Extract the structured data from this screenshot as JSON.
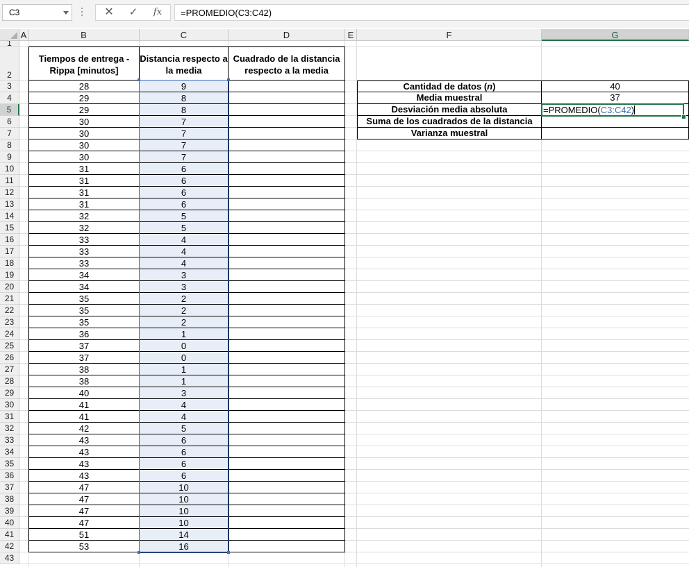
{
  "name_box": "C3",
  "formula_bar": {
    "cancel_icon": "✕",
    "enter_icon": "✓",
    "fx_label": "fx",
    "formula": "=PROMEDIO(C3:C42)"
  },
  "columns": [
    "A",
    "B",
    "C",
    "D",
    "E",
    "F",
    "G"
  ],
  "rows": [
    "1",
    "2",
    "3",
    "4",
    "5",
    "6",
    "7",
    "8",
    "9",
    "10",
    "11",
    "12",
    "13",
    "14",
    "15",
    "16",
    "17",
    "18",
    "19",
    "20",
    "21",
    "22",
    "23",
    "24",
    "25",
    "26",
    "27",
    "28",
    "29",
    "30",
    "31",
    "32",
    "33",
    "34",
    "35",
    "36",
    "37",
    "38",
    "39",
    "40",
    "41",
    "42",
    "43"
  ],
  "table": {
    "header_b": "Tiempos de entrega - Rippa [minutos]",
    "header_c": "Distancia respecto a la media",
    "header_d": "Cuadrado de la distancia respecto a la media",
    "b_values": [
      "28",
      "29",
      "29",
      "30",
      "30",
      "30",
      "30",
      "31",
      "31",
      "31",
      "31",
      "32",
      "32",
      "33",
      "33",
      "33",
      "34",
      "34",
      "35",
      "35",
      "35",
      "36",
      "37",
      "37",
      "38",
      "38",
      "40",
      "41",
      "41",
      "42",
      "43",
      "43",
      "43",
      "43",
      "47",
      "47",
      "47",
      "47",
      "51",
      "53"
    ],
    "c_values": [
      "9",
      "8",
      "8",
      "7",
      "7",
      "7",
      "7",
      "6",
      "6",
      "6",
      "6",
      "5",
      "5",
      "4",
      "4",
      "4",
      "3",
      "3",
      "2",
      "2",
      "2",
      "1",
      "0",
      "0",
      "1",
      "1",
      "3",
      "4",
      "4",
      "5",
      "6",
      "6",
      "6",
      "6",
      "10",
      "10",
      "10",
      "10",
      "14",
      "16"
    ]
  },
  "summary": {
    "label_n_prefix": "Cantidad de datos (",
    "label_n_var": "n",
    "label_n_suffix": ")",
    "value_n": "40",
    "label_mean": "Media muestral",
    "value_mean": "37",
    "label_mad": "Desviación media absoluta",
    "editing_formula_prefix": "=PROMEDIO(",
    "editing_formula_ref": "C3:C42",
    "editing_formula_suffix": ")",
    "label_sum_squares": "Suma de los cuadrados de la distancia",
    "label_variance": "Varianza muestral"
  },
  "colors": {
    "excel_green": "#217346",
    "range_blue": "#3e6fbd",
    "selection_fill": "#e8eef7"
  }
}
